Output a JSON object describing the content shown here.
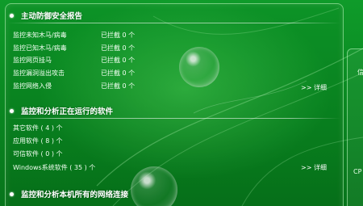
{
  "sections": [
    {
      "title": "主动防御安全报告",
      "rows": [
        {
          "label": "监控未知木马/病毒",
          "status": "已拦截 0 个"
        },
        {
          "label": "监控已知木马/病毒",
          "status": "已拦截 0 个"
        },
        {
          "label": "监控网页挂马",
          "status": "已拦截 0 个"
        },
        {
          "label": "监控漏洞溢出攻击",
          "status": "已拦截 0 个"
        },
        {
          "label": "监控网络入侵",
          "status": "已拦截 0 个"
        }
      ],
      "detail": ">> 详细"
    },
    {
      "title": "监控和分析正在运行的软件",
      "rows": [
        {
          "label": "其它软件 ( 4 ) 个"
        },
        {
          "label": "应用软件 ( 8 ) 个"
        },
        {
          "label": "可信软件 ( 0 ) 个"
        },
        {
          "label": "Windows系统软件 ( 35 ) 个"
        }
      ],
      "detail": ">> 详细"
    },
    {
      "title": "监控和分析本机所有的网络连接"
    }
  ],
  "side": {
    "top_text": "信",
    "bottom_text": "CP"
  }
}
